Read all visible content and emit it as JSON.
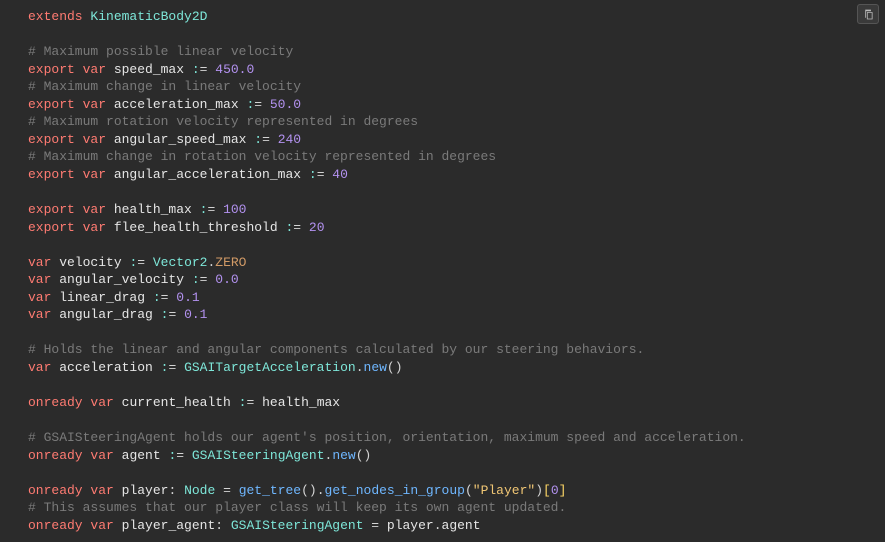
{
  "copy_button_title": "Copy",
  "code": {
    "lines": [
      {
        "tokens": [
          {
            "t": "extends ",
            "c": "kw"
          },
          {
            "t": "KinematicBody2D",
            "c": "type"
          }
        ]
      },
      {
        "tokens": []
      },
      {
        "tokens": [
          {
            "t": "# Maximum possible linear velocity",
            "c": "comment"
          }
        ]
      },
      {
        "tokens": [
          {
            "t": "export ",
            "c": "kw"
          },
          {
            "t": "var ",
            "c": "kw"
          },
          {
            "t": "speed_max ",
            "c": "ident"
          },
          {
            "t": ":",
            "c": "op"
          },
          {
            "t": "= ",
            "c": "eq"
          },
          {
            "t": "450.0",
            "c": "num"
          }
        ]
      },
      {
        "tokens": [
          {
            "t": "# Maximum change in linear velocity",
            "c": "comment"
          }
        ]
      },
      {
        "tokens": [
          {
            "t": "export ",
            "c": "kw"
          },
          {
            "t": "var ",
            "c": "kw"
          },
          {
            "t": "acceleration_max ",
            "c": "ident"
          },
          {
            "t": ":",
            "c": "op"
          },
          {
            "t": "= ",
            "c": "eq"
          },
          {
            "t": "50.0",
            "c": "num"
          }
        ]
      },
      {
        "tokens": [
          {
            "t": "# Maximum rotation velocity represented in degrees",
            "c": "comment"
          }
        ]
      },
      {
        "tokens": [
          {
            "t": "export ",
            "c": "kw"
          },
          {
            "t": "var ",
            "c": "kw"
          },
          {
            "t": "angular_speed_max ",
            "c": "ident"
          },
          {
            "t": ":",
            "c": "op"
          },
          {
            "t": "= ",
            "c": "eq"
          },
          {
            "t": "240",
            "c": "num"
          }
        ]
      },
      {
        "tokens": [
          {
            "t": "# Maximum change in rotation velocity represented in degrees",
            "c": "comment"
          }
        ]
      },
      {
        "tokens": [
          {
            "t": "export ",
            "c": "kw"
          },
          {
            "t": "var ",
            "c": "kw"
          },
          {
            "t": "angular_acceleration_max ",
            "c": "ident"
          },
          {
            "t": ":",
            "c": "op"
          },
          {
            "t": "= ",
            "c": "eq"
          },
          {
            "t": "40",
            "c": "num"
          }
        ]
      },
      {
        "tokens": []
      },
      {
        "tokens": [
          {
            "t": "export ",
            "c": "kw"
          },
          {
            "t": "var ",
            "c": "kw"
          },
          {
            "t": "health_max ",
            "c": "ident"
          },
          {
            "t": ":",
            "c": "op"
          },
          {
            "t": "= ",
            "c": "eq"
          },
          {
            "t": "100",
            "c": "num"
          }
        ]
      },
      {
        "tokens": [
          {
            "t": "export ",
            "c": "kw"
          },
          {
            "t": "var ",
            "c": "kw"
          },
          {
            "t": "flee_health_threshold ",
            "c": "ident"
          },
          {
            "t": ":",
            "c": "op"
          },
          {
            "t": "= ",
            "c": "eq"
          },
          {
            "t": "20",
            "c": "num"
          }
        ]
      },
      {
        "tokens": []
      },
      {
        "tokens": [
          {
            "t": "var ",
            "c": "kw"
          },
          {
            "t": "velocity ",
            "c": "ident"
          },
          {
            "t": ":",
            "c": "op"
          },
          {
            "t": "= ",
            "c": "eq"
          },
          {
            "t": "Vector2",
            "c": "type"
          },
          {
            "t": ".",
            "c": "punct"
          },
          {
            "t": "ZERO",
            "c": "prop"
          }
        ]
      },
      {
        "tokens": [
          {
            "t": "var ",
            "c": "kw"
          },
          {
            "t": "angular_velocity ",
            "c": "ident"
          },
          {
            "t": ":",
            "c": "op"
          },
          {
            "t": "= ",
            "c": "eq"
          },
          {
            "t": "0.0",
            "c": "num"
          }
        ]
      },
      {
        "tokens": [
          {
            "t": "var ",
            "c": "kw"
          },
          {
            "t": "linear_drag ",
            "c": "ident"
          },
          {
            "t": ":",
            "c": "op"
          },
          {
            "t": "= ",
            "c": "eq"
          },
          {
            "t": "0.1",
            "c": "num"
          }
        ]
      },
      {
        "tokens": [
          {
            "t": "var ",
            "c": "kw"
          },
          {
            "t": "angular_drag ",
            "c": "ident"
          },
          {
            "t": ":",
            "c": "op"
          },
          {
            "t": "= ",
            "c": "eq"
          },
          {
            "t": "0.1",
            "c": "num"
          }
        ]
      },
      {
        "tokens": []
      },
      {
        "tokens": [
          {
            "t": "# Holds the linear and angular components calculated by our steering behaviors.",
            "c": "comment"
          }
        ]
      },
      {
        "tokens": [
          {
            "t": "var ",
            "c": "kw"
          },
          {
            "t": "acceleration ",
            "c": "ident"
          },
          {
            "t": ":",
            "c": "op"
          },
          {
            "t": "= ",
            "c": "eq"
          },
          {
            "t": "GSAITargetAcceleration",
            "c": "type"
          },
          {
            "t": ".",
            "c": "punct"
          },
          {
            "t": "new",
            "c": "func"
          },
          {
            "t": "()",
            "c": "punct"
          }
        ]
      },
      {
        "tokens": []
      },
      {
        "tokens": [
          {
            "t": "onready ",
            "c": "kw"
          },
          {
            "t": "var ",
            "c": "kw"
          },
          {
            "t": "current_health ",
            "c": "ident"
          },
          {
            "t": ":",
            "c": "op"
          },
          {
            "t": "= ",
            "c": "eq"
          },
          {
            "t": "health_max",
            "c": "ident"
          }
        ]
      },
      {
        "tokens": []
      },
      {
        "tokens": [
          {
            "t": "# GSAISteeringAgent holds our agent's position, orientation, maximum speed and acceleration.",
            "c": "comment"
          }
        ]
      },
      {
        "tokens": [
          {
            "t": "onready ",
            "c": "kw"
          },
          {
            "t": "var ",
            "c": "kw"
          },
          {
            "t": "agent ",
            "c": "ident"
          },
          {
            "t": ":",
            "c": "op"
          },
          {
            "t": "= ",
            "c": "eq"
          },
          {
            "t": "GSAISteeringAgent",
            "c": "type"
          },
          {
            "t": ".",
            "c": "punct"
          },
          {
            "t": "new",
            "c": "func"
          },
          {
            "t": "()",
            "c": "punct"
          }
        ]
      },
      {
        "tokens": []
      },
      {
        "tokens": [
          {
            "t": "onready ",
            "c": "kw"
          },
          {
            "t": "var ",
            "c": "kw"
          },
          {
            "t": "player",
            "c": "ident"
          },
          {
            "t": ": ",
            "c": "punct"
          },
          {
            "t": "Node",
            "c": "type"
          },
          {
            "t": " = ",
            "c": "eq"
          },
          {
            "t": "get_tree",
            "c": "func"
          },
          {
            "t": "().",
            "c": "punct"
          },
          {
            "t": "get_nodes_in_group",
            "c": "func"
          },
          {
            "t": "(",
            "c": "punct"
          },
          {
            "t": "\"Player\"",
            "c": "str"
          },
          {
            "t": ")",
            "c": "punct"
          },
          {
            "t": "[",
            "c": "bracket"
          },
          {
            "t": "0",
            "c": "num"
          },
          {
            "t": "]",
            "c": "bracket"
          }
        ]
      },
      {
        "tokens": [
          {
            "t": "# This assumes that our player class will keep its own agent updated.",
            "c": "comment"
          }
        ]
      },
      {
        "tokens": [
          {
            "t": "onready ",
            "c": "kw"
          },
          {
            "t": "var ",
            "c": "kw"
          },
          {
            "t": "player_agent",
            "c": "ident"
          },
          {
            "t": ": ",
            "c": "punct"
          },
          {
            "t": "GSAISteeringAgent",
            "c": "type"
          },
          {
            "t": " = ",
            "c": "eq"
          },
          {
            "t": "player",
            "c": "ident"
          },
          {
            "t": ".",
            "c": "punct"
          },
          {
            "t": "agent",
            "c": "ident"
          }
        ]
      }
    ]
  }
}
